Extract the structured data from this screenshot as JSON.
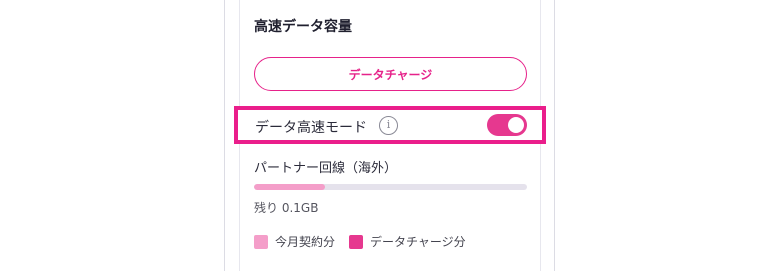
{
  "section": {
    "title": "高速データ容量"
  },
  "charge_button": {
    "label": "データチャージ"
  },
  "high_speed_mode": {
    "label": "データ高速モード",
    "info_icon": "info-circle-icon",
    "toggle_on": true
  },
  "partner_line": {
    "label": "パートナー回線（海外）",
    "usage_fraction": 0.26,
    "remaining_text": "残り  0.1GB"
  },
  "legend": [
    {
      "label": "今月契約分",
      "color": "#f49ec9"
    },
    {
      "label": "データチャージ分",
      "color": "#e6388f"
    }
  ],
  "colors": {
    "accent": "#e6228a",
    "highlight_border": "#ea1e8b",
    "track": "#e5e2ec"
  }
}
